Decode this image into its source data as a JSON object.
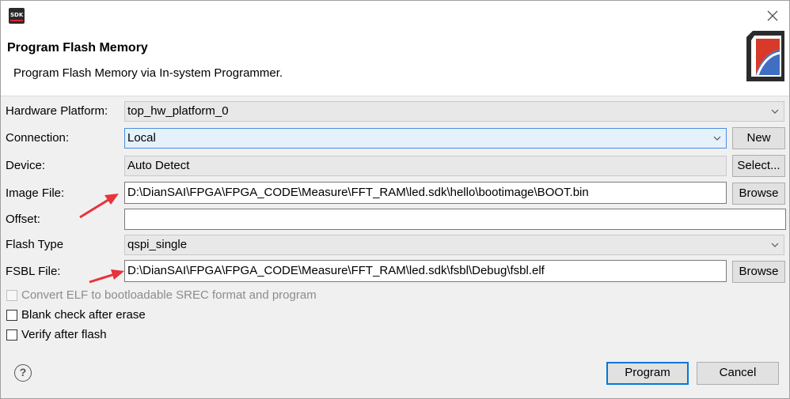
{
  "window": {
    "app_icon_text": "SDK",
    "close_icon": "close-icon"
  },
  "banner": {
    "title": "Program Flash Memory",
    "description": "Program Flash Memory via In-system Programmer."
  },
  "form": {
    "hardware_platform": {
      "label": "Hardware Platform:",
      "value": "top_hw_platform_0"
    },
    "connection": {
      "label": "Connection:",
      "value": "Local",
      "button": "New"
    },
    "device": {
      "label": "Device:",
      "value": "Auto Detect",
      "button": "Select..."
    },
    "image_file": {
      "label": "Image File:",
      "value": "D:\\DianSAI\\FPGA\\FPGA_CODE\\Measure\\FFT_RAM\\led.sdk\\hello\\bootimage\\BOOT.bin",
      "button": "Browse"
    },
    "offset": {
      "label": "Offset:",
      "value": ""
    },
    "flash_type": {
      "label": "Flash Type",
      "value": "qspi_single"
    },
    "fsbl_file": {
      "label": "FSBL File:",
      "value": "D:\\DianSAI\\FPGA\\FPGA_CODE\\Measure\\FFT_RAM\\led.sdk\\fsbl\\Debug\\fsbl.elf",
      "button": "Browse"
    }
  },
  "options": {
    "convert_elf": {
      "label": "Convert ELF to bootloadable SREC format and program",
      "checked": false,
      "enabled": false
    },
    "blank_check": {
      "label": "Blank check after erase",
      "checked": false
    },
    "verify": {
      "label": "Verify after flash",
      "checked": false
    }
  },
  "footer": {
    "help_glyph": "?",
    "program_label": "Program",
    "cancel_label": "Cancel"
  },
  "colors": {
    "accent": "#0078d7",
    "annotation_arrow": "#e8323c"
  }
}
